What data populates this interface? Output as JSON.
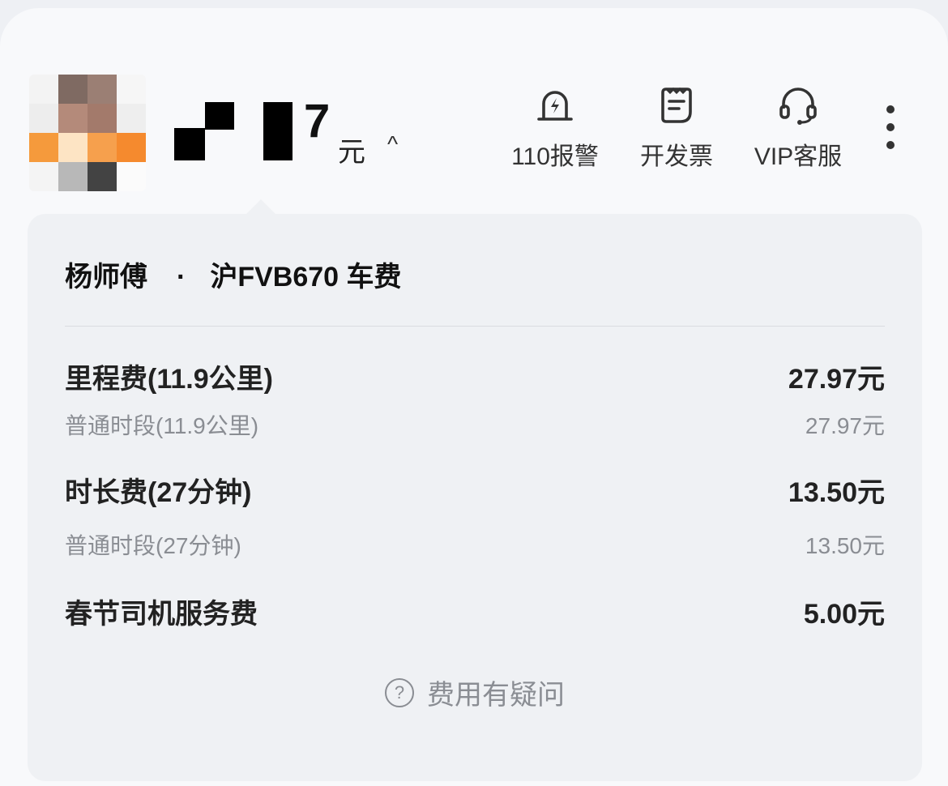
{
  "header": {
    "amount_suffix": "元",
    "amount_last_digit": "7",
    "collapse_caret": "^",
    "actions": [
      {
        "label": "110报警",
        "icon": "alarm-icon"
      },
      {
        "label": "开发票",
        "icon": "invoice-icon"
      },
      {
        "label": "VIP客服",
        "icon": "headset-icon"
      }
    ],
    "more_icon": "more-vertical-icon"
  },
  "detail": {
    "driver": "杨师傅",
    "separator": "·",
    "plate_title": "沪FVB670 车费",
    "items": [
      {
        "label": "里程费(11.9公里)",
        "value": "27.97元",
        "kind": "main"
      },
      {
        "label": "普通时段(11.9公里)",
        "value": "27.97元",
        "kind": "sub"
      },
      {
        "label": "时长费(27分钟)",
        "value": "13.50元",
        "kind": "main"
      },
      {
        "label": "普通时段(27分钟)",
        "value": "13.50元",
        "kind": "sub"
      },
      {
        "label": "春节司机服务费",
        "value": "5.00元",
        "kind": "main"
      }
    ],
    "question_icon": "?",
    "question_label": "费用有疑问"
  },
  "colors": {
    "background": "#f8f9fb",
    "card": "#eff1f4",
    "text_primary": "#222222",
    "text_secondary": "#8a8d93"
  }
}
